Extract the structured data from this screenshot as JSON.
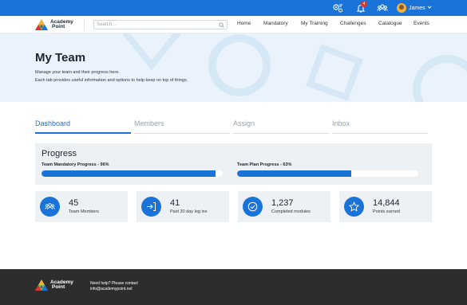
{
  "topbar": {
    "notification_count": "4",
    "user_name": "James",
    "icons": [
      "settings-icon",
      "bell-icon",
      "team-icon",
      "chevron-down-icon"
    ]
  },
  "header": {
    "logo_line1": "Academy",
    "logo_line2": "Point",
    "search_placeholder": "Search...",
    "nav": [
      "Home",
      "Mandatory",
      "My Training",
      "Challenges",
      "Catalogue",
      "Events"
    ]
  },
  "hero": {
    "title": "My Team",
    "line1": "Manage your team and their progress here.",
    "line2": "Each tab provides useful information and options to help keep on top of things."
  },
  "tabs": [
    "Dashboard",
    "Members",
    "Assign",
    "Inbox"
  ],
  "progress": {
    "title": "Progress",
    "mandatory_label": "Team Mandatory Progress - 96%",
    "mandatory_value": 0.96,
    "plan_label": "Team Plan Progress - 63%",
    "plan_value": 0.63
  },
  "stats": [
    {
      "value": "45",
      "label": "Team Members",
      "icon": "people-icon"
    },
    {
      "value": "41",
      "label": "Past 30 day log ins",
      "icon": "login-icon"
    },
    {
      "value": "1,237",
      "label": "Completed modules",
      "icon": "check-circle-icon"
    },
    {
      "value": "14,844",
      "label": "Points earned",
      "icon": "star-icon"
    }
  ],
  "footer": {
    "logo_line1": "Academy",
    "logo_line2": "Point",
    "help_line1": "Need help? Please contact",
    "help_line2": "info@academypoint.net"
  },
  "colors": {
    "primary": "#1a73d9",
    "hero_bg": "#eaf3fb",
    "card_bg": "#eef1f4",
    "footer_bg": "#2d2d2d",
    "badge": "#e0342b"
  }
}
